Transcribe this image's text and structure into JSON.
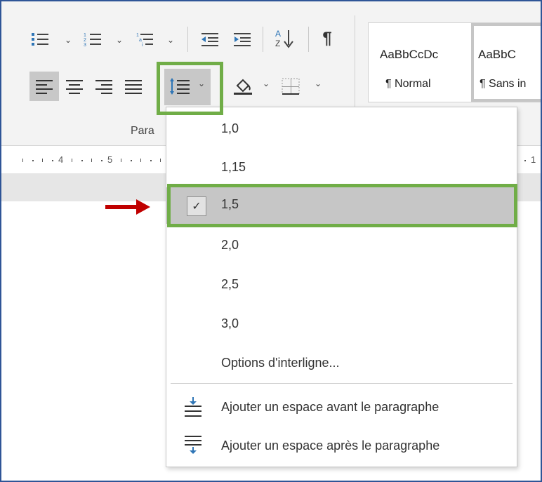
{
  "paragraph_group": {
    "label": "Para",
    "pilcrow": "¶"
  },
  "ruler": {
    "ticks": [
      "4",
      "5",
      "1"
    ]
  },
  "styles": [
    {
      "sample": "AaBbCcDc",
      "name": "¶ Normal",
      "selected": false
    },
    {
      "sample": "AaBbC",
      "name": "¶ Sans in",
      "selected": true
    }
  ],
  "line_spacing_menu": {
    "options": [
      {
        "label": "1,0",
        "checked": false
      },
      {
        "label": "1,15",
        "checked": false
      },
      {
        "label": "1,5",
        "checked": true
      },
      {
        "label": "2,0",
        "checked": false
      },
      {
        "label": "2,5",
        "checked": false
      },
      {
        "label": "3,0",
        "checked": false
      }
    ],
    "more_options": "Options d'interligne...",
    "add_space_before": "Ajouter un espace avant le paragraphe",
    "add_space_after": "Ajouter un espace après le paragraphe",
    "checkmark": "✓"
  },
  "colors": {
    "highlight_green": "#70ad47",
    "annotation_arrow": "#c00000",
    "frame_border": "#2f5597",
    "selected_item_bg": "#c6c6c6",
    "blue_icon": "#2e75b6"
  }
}
